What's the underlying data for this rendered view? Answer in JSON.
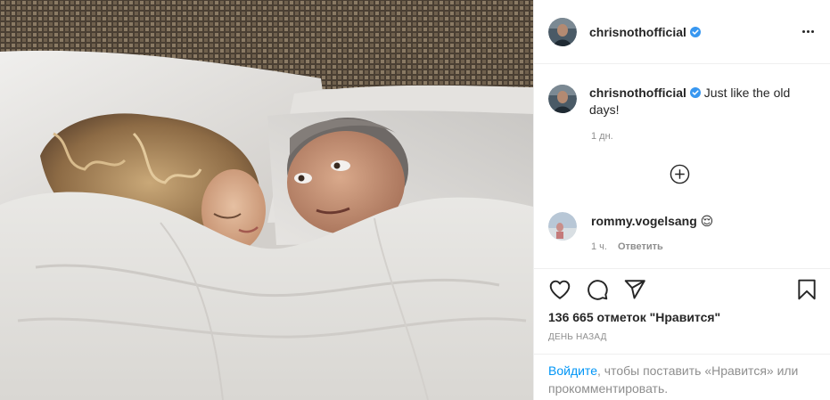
{
  "post": {
    "author": {
      "username": "chrisnothofficial",
      "verified_icon": "verified-badge-icon",
      "avatar_icon": "user-avatar"
    },
    "caption": {
      "username": "chrisnothofficial",
      "text": "Just like the old days!",
      "time": "1 дн."
    },
    "comments": [
      {
        "username": "rommy.vogelsang",
        "text": "😌",
        "time": "1 ч.",
        "reply_label": "Ответить"
      }
    ],
    "likes_text": "136 665 отметок \"Нравится\"",
    "date_text": "ДЕНЬ НАЗАД",
    "login_prompt": {
      "link_text": "Войдите",
      "rest_text": ", чтобы поставить «Нравится» или прокомментировать."
    },
    "colors": {
      "accent": "#0095f6",
      "text": "#262626",
      "muted": "#8e8e8e",
      "divider": "#efefef"
    },
    "icons": [
      "more-options-icon",
      "load-more-comments-icon",
      "heart-icon",
      "comment-icon",
      "share-icon",
      "bookmark-icon"
    ]
  }
}
